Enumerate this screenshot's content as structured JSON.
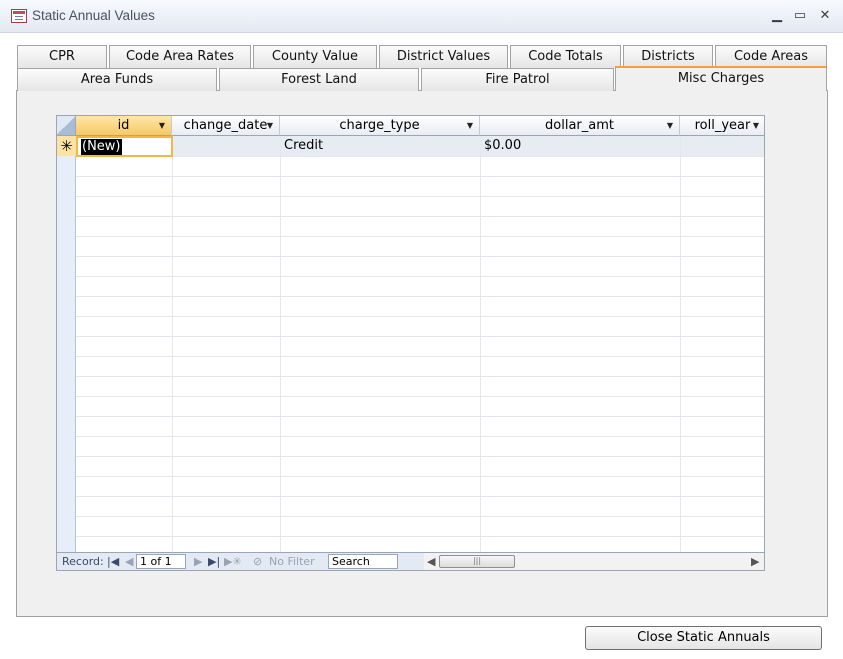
{
  "window": {
    "title": "Static Annual Values",
    "minimize": "▁",
    "maximize": "▭",
    "close": "✕"
  },
  "tabs": {
    "row1": [
      "CPR",
      "Code Area Rates",
      "County Value",
      "District Values",
      "Code Totals",
      "Districts",
      "Code Areas"
    ],
    "row2": [
      "Area Funds",
      "Forest Land",
      "Fire Patrol",
      "Misc Charges"
    ]
  },
  "datasheet": {
    "columns": [
      "id",
      "change_date",
      "charge_type",
      "dollar_amt",
      "roll_year"
    ],
    "new_row": {
      "marker": "✳",
      "id": "(New)",
      "change_date": "",
      "charge_type": "Credit",
      "dollar_amt": "$0.00",
      "roll_year": ""
    }
  },
  "navigation": {
    "record_label": "Record:",
    "first": "|◀",
    "prev": "◀",
    "record_position": "1 of 1",
    "next": "▶",
    "last": "▶|",
    "new": "▶✳",
    "filter_icon": "⊘",
    "filter_label": "No Filter",
    "search_placeholder": "Search",
    "scroll_left": "◀",
    "scroll_right": "▶",
    "thumb_grip": "|||"
  },
  "buttons": {
    "close_label": "Close Static Annuals"
  }
}
